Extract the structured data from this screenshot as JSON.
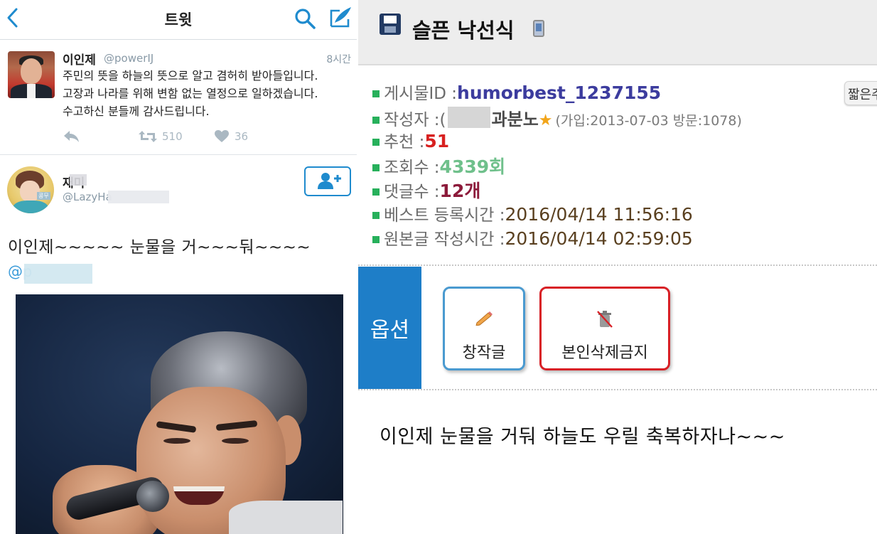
{
  "twitter": {
    "header": {
      "title": "트윗"
    },
    "tweet1": {
      "name": "이인제",
      "handle": "@powerIJ",
      "time": "8시간",
      "text": "주민의 뜻을 하늘의 뜻으로 알고 겸허히 받아들입니다.\n고장과 나라를 위해 변함 없는 열정으로 일하겠습니다.\n수고하신 분들께 감사드립니다.",
      "retweets": "510",
      "likes": "36"
    },
    "tweet2": {
      "name": "재미",
      "handle": "@LazyHa",
      "avatar_tag": "콩무",
      "text": "이인제~~~~~ 눈물을 거~~~둬~~~~",
      "mention": "@p"
    }
  },
  "board": {
    "title": "슬픈 낙선식",
    "short_button": "짧은주",
    "info": {
      "post_id_label": "게시물ID : ",
      "post_id": "humorbest_1237155",
      "author_label": "작성자 : ",
      "author_prefix": "(",
      "author_name": "과분노",
      "author_star": "★",
      "author_meta": "(가입:2013-07-03 방문:1078)",
      "recommend_label": "추천 : ",
      "recommend": "51",
      "views_label": "조회수 : ",
      "views": "4339회",
      "comments_label": "댓글수 : ",
      "comments": "12개",
      "best_time_label": "베스트 등록시간 : ",
      "best_time": "2016/04/14 11:56:16",
      "orig_time_label": "원본글 작성시간 : ",
      "orig_time": "2016/04/14 02:59:05"
    },
    "options": {
      "label": "옵션",
      "original_label": "창작글",
      "no_delete_label": "본인삭제금지"
    },
    "body_text": "이인제 눈물을 거둬 하늘도 우릴 축복하자나~~~"
  },
  "colors": {
    "twitter_blue": "#1f8bce",
    "option_blue": "#1e7ec8",
    "bullet_green": "#27b05b",
    "post_id": "#3c3c9e",
    "recommend": "#d8201f",
    "views": "#6fc08b",
    "comments": "#8c1a3a"
  }
}
